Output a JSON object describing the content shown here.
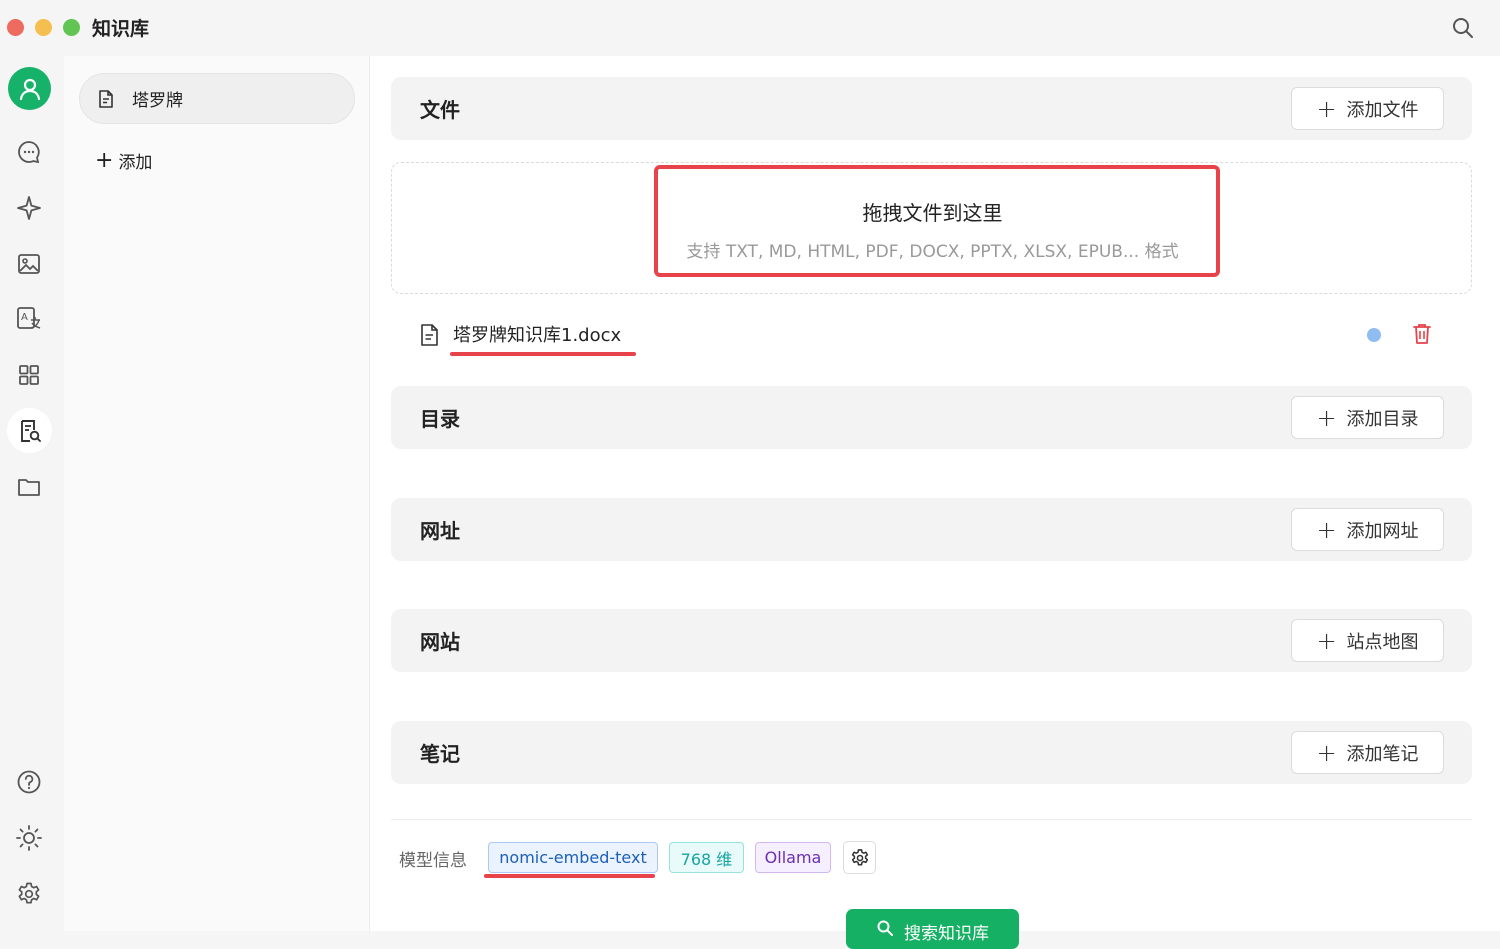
{
  "window": {
    "title": "知识库"
  },
  "sidebar_icons": [
    "avatar-icon",
    "chat-icon",
    "sparkle-icon",
    "image-icon",
    "translate-icon",
    "apps-icon",
    "knowledge-icon",
    "folder-icon",
    "help-icon",
    "theme-icon",
    "settings-icon"
  ],
  "knowledge_bases": {
    "items": [
      {
        "label": "塔罗牌",
        "icon": "document-icon"
      }
    ],
    "add_label": "添加"
  },
  "sections": {
    "files": {
      "title": "文件",
      "button": "添加文件"
    },
    "directory": {
      "title": "目录",
      "button": "添加目录"
    },
    "urls": {
      "title": "网址",
      "button": "添加网址"
    },
    "websites": {
      "title": "网站",
      "button": "站点地图"
    },
    "notes": {
      "title": "笔记",
      "button": "添加笔记"
    }
  },
  "dropzone": {
    "title": "拖拽文件到这里",
    "subtitle": "支持 TXT, MD, HTML, PDF, DOCX, PPTX, XLSX, EPUB... 格式"
  },
  "files": [
    {
      "name": "塔罗牌知识库1.docx"
    }
  ],
  "model_info": {
    "label": "模型信息",
    "model": "nomic-embed-text",
    "dimensions": "768 维",
    "provider": "Ollama"
  },
  "search_button": "搜索知识库",
  "colors": {
    "accent": "#16b064",
    "highlight": "#e8424a",
    "status_dot": "#8fbdf2"
  }
}
